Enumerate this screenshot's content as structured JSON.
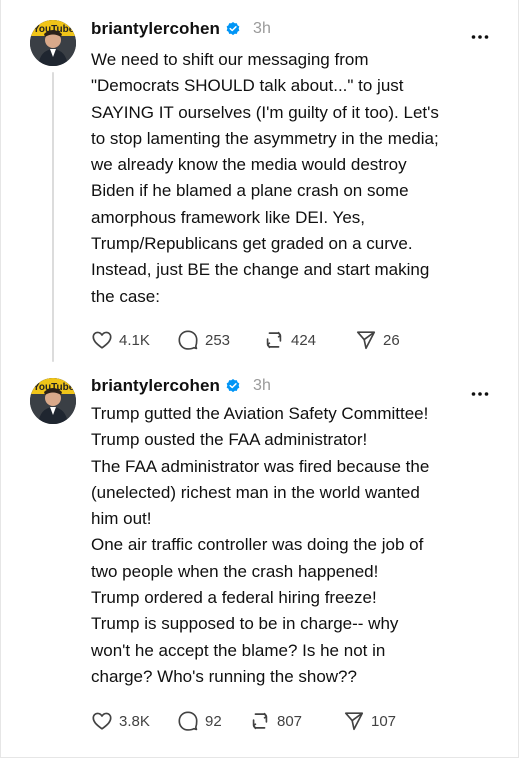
{
  "posts": [
    {
      "username": "briantylercohen",
      "time": "3h",
      "body": "We need to shift our messaging from\n\"Democrats SHOULD talk about...\" to just\nSAYING IT ourselves (I'm guilty of it too). Let's\nto stop lamenting the asymmetry in the media;\nwe already know the media would destroy\nBiden if he blamed a plane crash on some\namorphous framework like DEI. Yes,\nTrump/Republicans get graded on a curve.\nInstead, just BE the change and start making\nthe case:",
      "likes": "4.1K",
      "replies": "253",
      "reposts": "424",
      "shares": "26"
    },
    {
      "username": "briantylercohen",
      "time": "3h",
      "body": "Trump gutted the Aviation Safety Committee!\nTrump ousted the FAA administrator!\nThe FAA administrator was fired because the\n(unelected) richest man in the world wanted\nhim out!\nOne air traffic controller was doing the job of\ntwo people when the crash happened!\nTrump ordered a federal hiring freeze!\nTrump is supposed to be in charge-- why\nwon't he accept the blame? Is he not in\ncharge? Who's running the show??",
      "likes": "3.8K",
      "replies": "92",
      "reposts": "807",
      "shares": "107"
    }
  ],
  "avatar_badge_text": "YouTube",
  "colors": {
    "verified": "#0095f6",
    "muted": "#9a9a9a",
    "text": "#101010",
    "icon": "#424242"
  }
}
